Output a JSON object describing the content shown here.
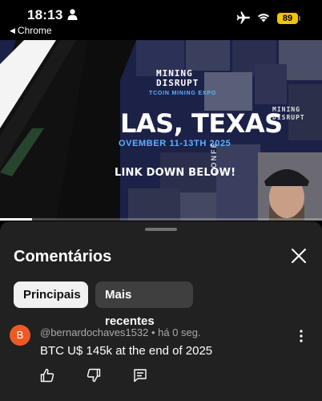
{
  "status_bar": {
    "time": "18:13",
    "back_app": "Chrome",
    "battery": "89",
    "icons": [
      "person-icon",
      "airplane-icon",
      "wifi-icon",
      "battery-icon"
    ],
    "battery_color": "#f2c500"
  },
  "video": {
    "logo_primary": "MINING\nDISRUPT",
    "logo_tagline": "TCOIN MINING EXPO",
    "logo_secondary": "MINING\nDISRUPT",
    "hero_title": "LAS, TEXAS",
    "hero_date": "OVEMBER 11-13TH 2025",
    "hero_link": "LINK DOWN BELOW!",
    "side_text": "CONFE",
    "progress_fraction": 0.1,
    "accent_color": "#5ab3ff"
  },
  "comments_sheet": {
    "title": "Comentários",
    "close_icon": "close-icon",
    "filters": [
      {
        "label": "Principais",
        "selected": true
      },
      {
        "label": "Mais recentes",
        "selected": false
      }
    ],
    "comments": [
      {
        "avatar_letter": "B",
        "avatar_color": "#ef5a24",
        "meta": "@bernardochaves1532 • há 0 seg.",
        "text": "BTC U$ 145k at the end of 2025",
        "actions": [
          "thumbs-up-icon",
          "thumbs-down-icon",
          "reply-icon"
        ]
      }
    ]
  }
}
